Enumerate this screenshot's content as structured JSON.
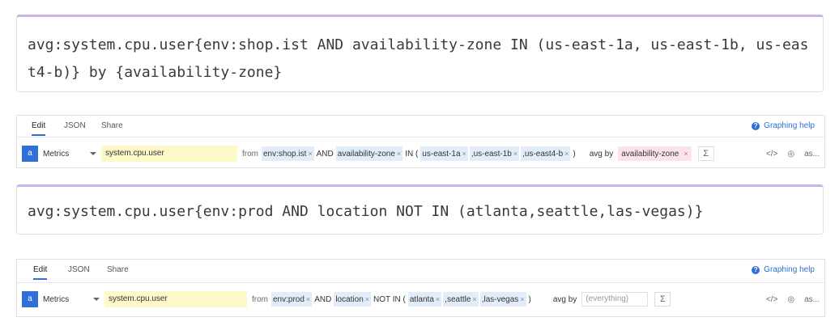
{
  "blocks": [
    {
      "query": "avg:system.cpu.user{env:shop.ist AND availability-zone IN (us-east-1a, us-east-1b, us-east4-b)} by {availability-zone}",
      "editor": {
        "tabs": [
          "Edit",
          "JSON",
          "Share"
        ],
        "help": "Graphing help",
        "badge": "a",
        "source": "Metrics",
        "metric": "system.cpu.user",
        "from_label": "from",
        "filters": {
          "env": "env:shop.ist",
          "and": "AND",
          "key": "availability-zone",
          "op": "IN (",
          "values": [
            "us-east-1a",
            ",us-east-1b",
            ",us-east4-b"
          ],
          "close": ")"
        },
        "avg_by_label": "avg by",
        "group": "availability-zone",
        "sigma": "Σ",
        "tools": [
          "</>",
          "◎",
          "as..."
        ]
      }
    },
    {
      "query": "avg:system.cpu.user{env:prod AND location NOT IN (atlanta,seattle,las-vegas)}",
      "editor": {
        "tabs": [
          "Edit",
          "JSON",
          "Share"
        ],
        "help": "Graphing help",
        "badge": "a",
        "source": "Metrics",
        "metric": "system.cpu.user",
        "from_label": "from",
        "filters": {
          "env": "env:prod",
          "and": "AND",
          "key": "location",
          "op": "NOT IN (",
          "values": [
            "atlanta",
            ",seattle",
            ",las-vegas"
          ],
          "close": ")"
        },
        "avg_by_label": "avg by",
        "group": "(everything)",
        "sigma": "Σ",
        "tools": [
          "</>",
          "◎",
          "as..."
        ]
      }
    }
  ]
}
